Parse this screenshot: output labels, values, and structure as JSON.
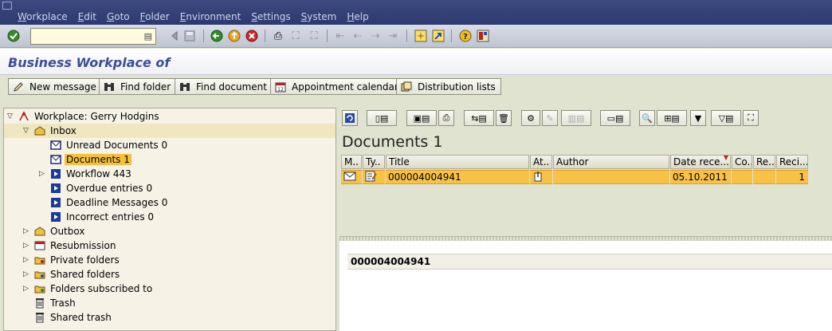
{
  "menu": [
    "Workplace",
    "Edit",
    "Goto",
    "Folder",
    "Environment",
    "Settings",
    "System",
    "Help"
  ],
  "command_field": {
    "value": ""
  },
  "title": "Business Workplace of",
  "app_toolbar": {
    "new_message": "New message",
    "find_folder": "Find folder",
    "find_document": "Find document",
    "appointment_calendar": "Appointment calendar",
    "distribution_lists": "Distribution lists"
  },
  "tree": {
    "root": "Workplace: Gerry Hodgins",
    "inbox": "Inbox",
    "inbox_items": [
      "Unread Documents 0",
      "Documents 1",
      "Workflow 443",
      "Overdue entries 0",
      "Deadline Messages 0",
      "Incorrect entries 0"
    ],
    "folders": [
      "Outbox",
      "Resubmission",
      "Private folders",
      "Shared folders",
      "Folders subscribed to",
      "Trash",
      "Shared trash"
    ]
  },
  "documents": {
    "heading": "Documents 1",
    "columns": [
      "M..",
      "Ty..",
      "Title",
      "At..",
      "Author",
      "Date rece...",
      "Co..",
      "Re..",
      "Reci..."
    ],
    "rows": [
      {
        "title": "000004004941",
        "author": "",
        "date": "05.10.2011",
        "recipients": "1"
      }
    ]
  },
  "preview": {
    "title": "000004004941"
  },
  "colors": {
    "menubar": "#2c3a70",
    "selection": "#f8c246",
    "title": "#3a4f95"
  }
}
